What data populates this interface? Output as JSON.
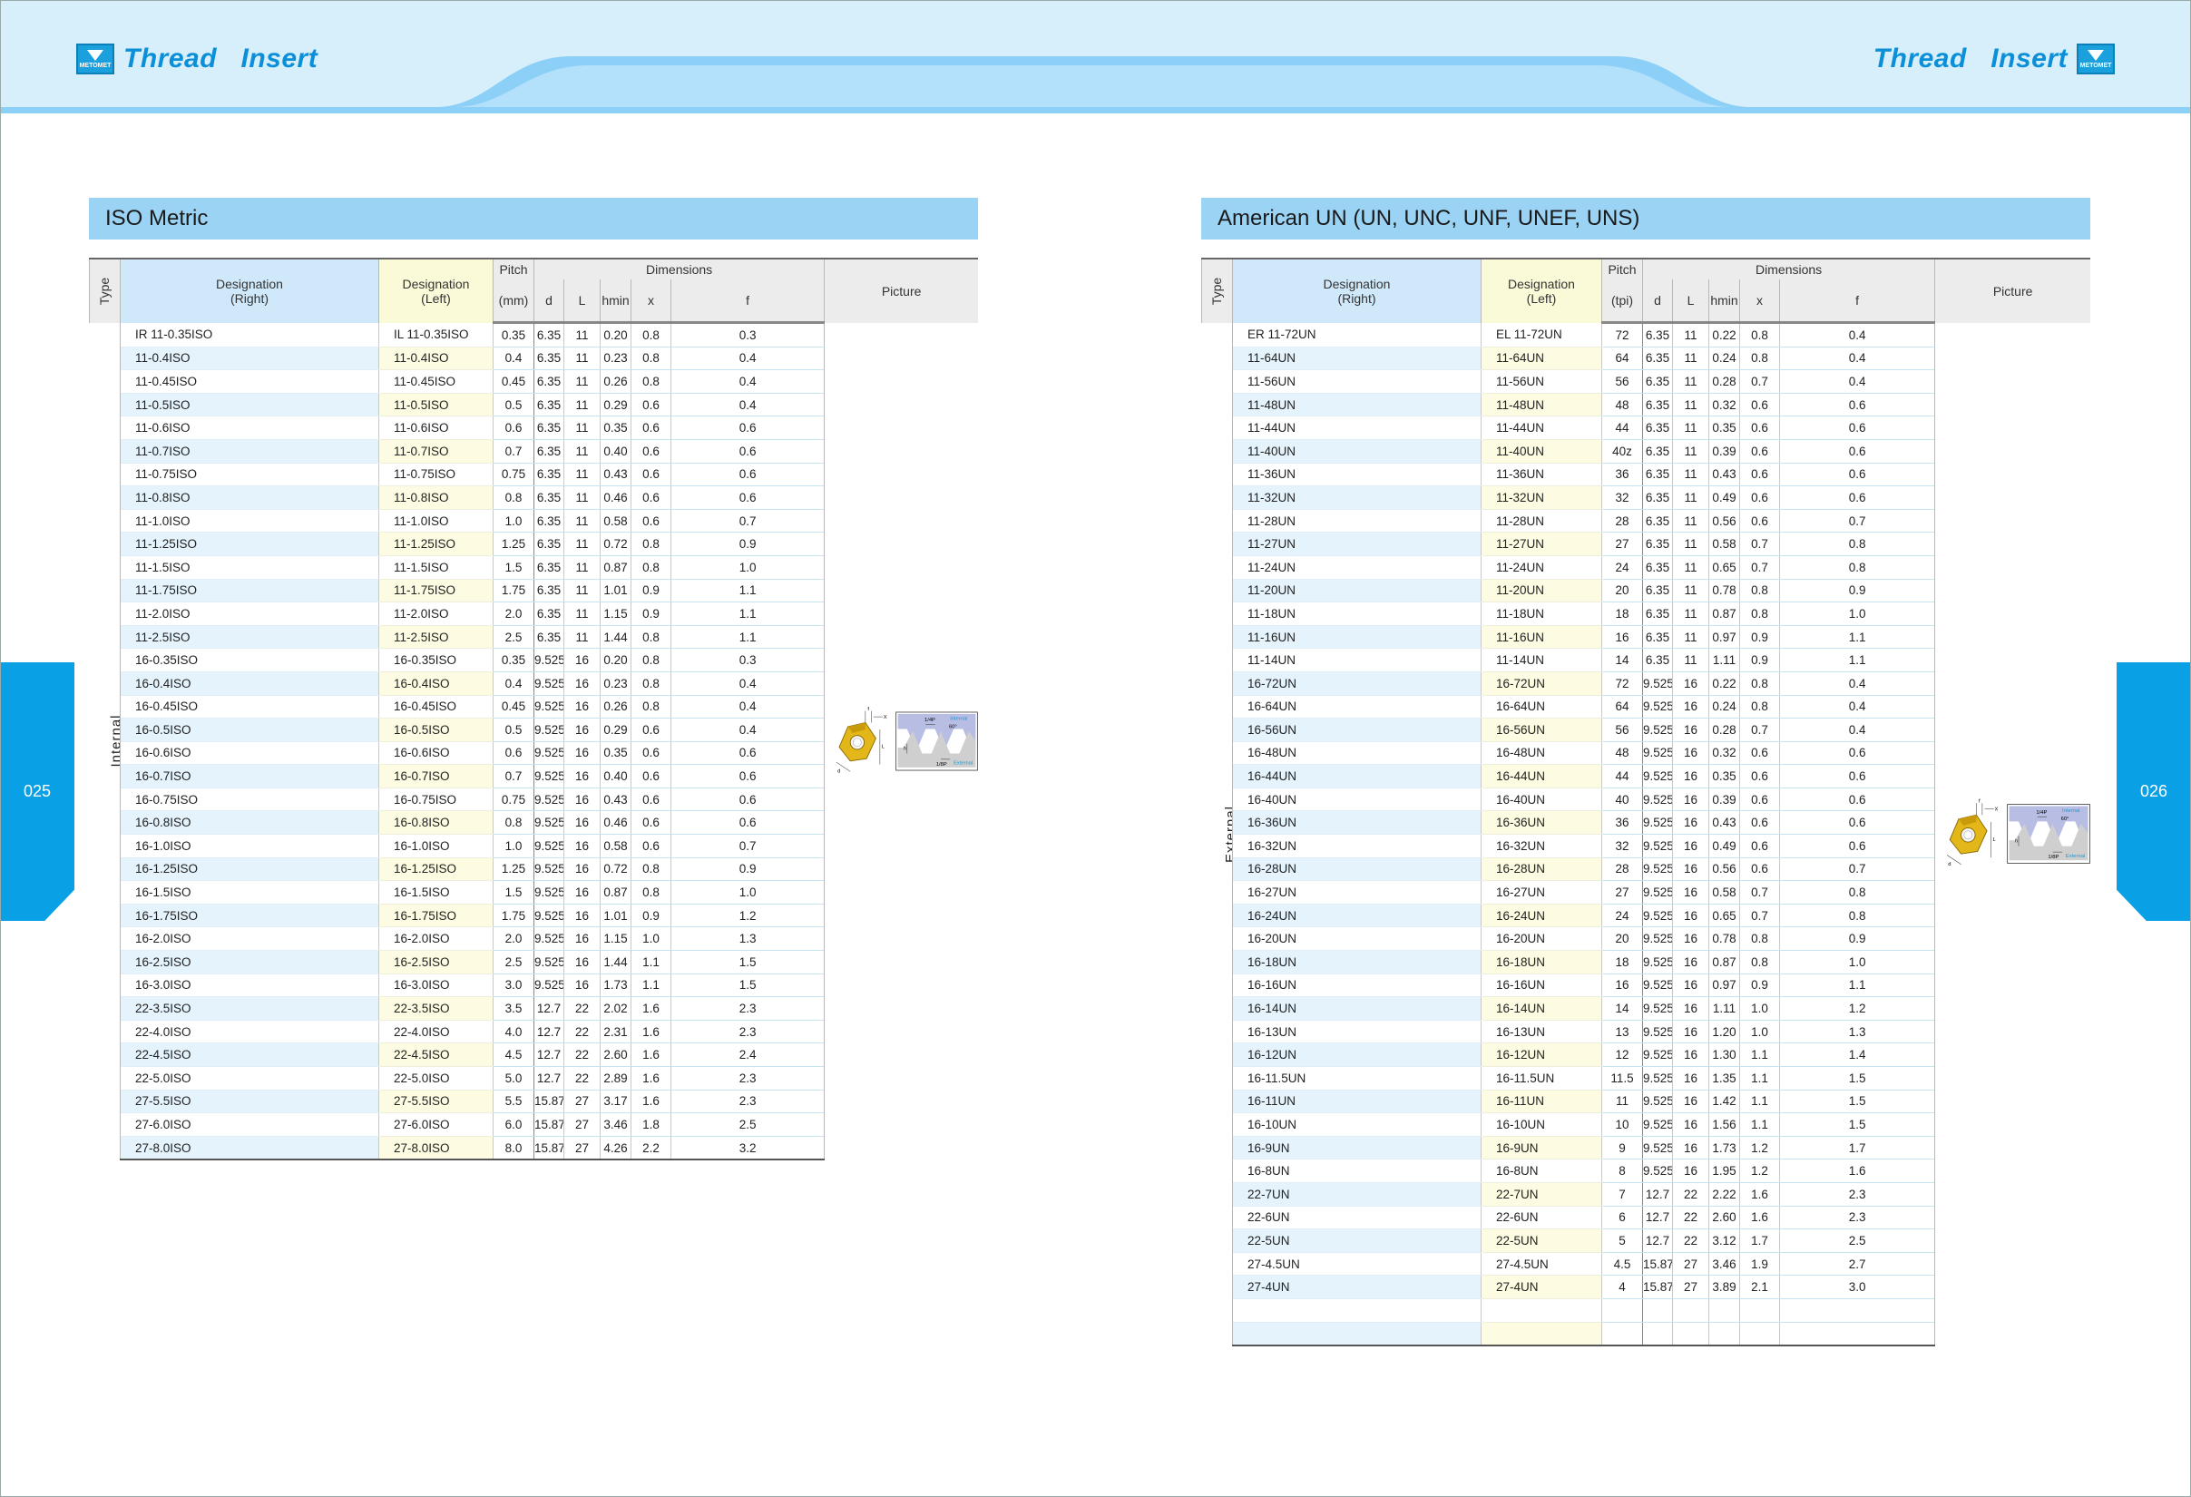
{
  "colors": {
    "accent": "#0a8fd8",
    "header_band": "#d7eefb",
    "wave": "#8cd0f7",
    "tab": "#0aa0e6",
    "section_title_bg": "#9bd3f5",
    "right_col_bg": "#cfe9fa",
    "left_col_bg": "#fbfad8"
  },
  "brand": {
    "logo_text": "METOMET",
    "title_left": "Thread   Insert",
    "title_right": "Thread   Insert"
  },
  "page_numbers": {
    "left": "025",
    "right": "026"
  },
  "headers": {
    "type": "Type",
    "designation_right": "Designation\n(Right)",
    "designation_left": "Designation\n(Left)",
    "dimensions": "Dimensions",
    "picture": "Picture",
    "d": "d",
    "L": "L",
    "hmin": "hmin",
    "x": "x",
    "f": "f",
    "pitch": "Pitch",
    "unit_mm": "(mm)",
    "unit_tpi": "(tpi)"
  },
  "diagram_labels": {
    "quarter_p": "1/4P",
    "eighth_p": "1/8P",
    "angle": "60°",
    "internal": "Internal",
    "external": "External",
    "f": "f",
    "x": "X",
    "L": "L",
    "d": "d",
    "h": "h"
  },
  "iso_metric": {
    "title": "ISO Metric",
    "type_label": "Internal",
    "rows": [
      [
        "IR  11-0.35ISO",
        "IL  11-0.35ISO",
        "0.35",
        "6.35",
        "11",
        "0.20",
        "0.8",
        "0.3"
      ],
      [
        "11-0.4ISO",
        "11-0.4ISO",
        "0.4",
        "6.35",
        "11",
        "0.23",
        "0.8",
        "0.4"
      ],
      [
        "11-0.45ISO",
        "11-0.45ISO",
        "0.45",
        "6.35",
        "11",
        "0.26",
        "0.8",
        "0.4"
      ],
      [
        "11-0.5ISO",
        "11-0.5ISO",
        "0.5",
        "6.35",
        "11",
        "0.29",
        "0.6",
        "0.4"
      ],
      [
        "11-0.6ISO",
        "11-0.6ISO",
        "0.6",
        "6.35",
        "11",
        "0.35",
        "0.6",
        "0.6"
      ],
      [
        "11-0.7ISO",
        "11-0.7ISO",
        "0.7",
        "6.35",
        "11",
        "0.40",
        "0.6",
        "0.6"
      ],
      [
        "11-0.75ISO",
        "11-0.75ISO",
        "0.75",
        "6.35",
        "11",
        "0.43",
        "0.6",
        "0.6"
      ],
      [
        "11-0.8ISO",
        "11-0.8ISO",
        "0.8",
        "6.35",
        "11",
        "0.46",
        "0.6",
        "0.6"
      ],
      [
        "11-1.0ISO",
        "11-1.0ISO",
        "1.0",
        "6.35",
        "11",
        "0.58",
        "0.6",
        "0.7"
      ],
      [
        "11-1.25ISO",
        "11-1.25ISO",
        "1.25",
        "6.35",
        "11",
        "0.72",
        "0.8",
        "0.9"
      ],
      [
        "11-1.5ISO",
        "11-1.5ISO",
        "1.5",
        "6.35",
        "11",
        "0.87",
        "0.8",
        "1.0"
      ],
      [
        "11-1.75ISO",
        "11-1.75ISO",
        "1.75",
        "6.35",
        "11",
        "1.01",
        "0.9",
        "1.1"
      ],
      [
        "11-2.0ISO",
        "11-2.0ISO",
        "2.0",
        "6.35",
        "11",
        "1.15",
        "0.9",
        "1.1"
      ],
      [
        "11-2.5ISO",
        "11-2.5ISO",
        "2.5",
        "6.35",
        "11",
        "1.44",
        "0.8",
        "1.1"
      ],
      [
        "16-0.35ISO",
        "16-0.35ISO",
        "0.35",
        "9.525",
        "16",
        "0.20",
        "0.8",
        "0.3"
      ],
      [
        "16-0.4ISO",
        "16-0.4ISO",
        "0.4",
        "9.525",
        "16",
        "0.23",
        "0.8",
        "0.4"
      ],
      [
        "16-0.45ISO",
        "16-0.45ISO",
        "0.45",
        "9.525",
        "16",
        "0.26",
        "0.8",
        "0.4"
      ],
      [
        "16-0.5ISO",
        "16-0.5ISO",
        "0.5",
        "9.525",
        "16",
        "0.29",
        "0.6",
        "0.4"
      ],
      [
        "16-0.6ISO",
        "16-0.6ISO",
        "0.6",
        "9.525",
        "16",
        "0.35",
        "0.6",
        "0.6"
      ],
      [
        "16-0.7ISO",
        "16-0.7ISO",
        "0.7",
        "9.525",
        "16",
        "0.40",
        "0.6",
        "0.6"
      ],
      [
        "16-0.75ISO",
        "16-0.75ISO",
        "0.75",
        "9.525",
        "16",
        "0.43",
        "0.6",
        "0.6"
      ],
      [
        "16-0.8ISO",
        "16-0.8ISO",
        "0.8",
        "9.525",
        "16",
        "0.46",
        "0.6",
        "0.6"
      ],
      [
        "16-1.0ISO",
        "16-1.0ISO",
        "1.0",
        "9.525",
        "16",
        "0.58",
        "0.6",
        "0.7"
      ],
      [
        "16-1.25ISO",
        "16-1.25ISO",
        "1.25",
        "9.525",
        "16",
        "0.72",
        "0.8",
        "0.9"
      ],
      [
        "16-1.5ISO",
        "16-1.5ISO",
        "1.5",
        "9.525",
        "16",
        "0.87",
        "0.8",
        "1.0"
      ],
      [
        "16-1.75ISO",
        "16-1.75ISO",
        "1.75",
        "9.525",
        "16",
        "1.01",
        "0.9",
        "1.2"
      ],
      [
        "16-2.0ISO",
        "16-2.0ISO",
        "2.0",
        "9.525",
        "16",
        "1.15",
        "1.0",
        "1.3"
      ],
      [
        "16-2.5ISO",
        "16-2.5ISO",
        "2.5",
        "9.525",
        "16",
        "1.44",
        "1.1",
        "1.5"
      ],
      [
        "16-3.0ISO",
        "16-3.0ISO",
        "3.0",
        "9.525",
        "16",
        "1.73",
        "1.1",
        "1.5"
      ],
      [
        "22-3.5ISO",
        "22-3.5ISO",
        "3.5",
        "12.7",
        "22",
        "2.02",
        "1.6",
        "2.3"
      ],
      [
        "22-4.0ISO",
        "22-4.0ISO",
        "4.0",
        "12.7",
        "22",
        "2.31",
        "1.6",
        "2.3"
      ],
      [
        "22-4.5ISO",
        "22-4.5ISO",
        "4.5",
        "12.7",
        "22",
        "2.60",
        "1.6",
        "2.4"
      ],
      [
        "22-5.0ISO",
        "22-5.0ISO",
        "5.0",
        "12.7",
        "22",
        "2.89",
        "1.6",
        "2.3"
      ],
      [
        "27-5.5ISO",
        "27-5.5ISO",
        "5.5",
        "15.875",
        "27",
        "3.17",
        "1.6",
        "2.3"
      ],
      [
        "27-6.0ISO",
        "27-6.0ISO",
        "6.0",
        "15.875",
        "27",
        "3.46",
        "1.8",
        "2.5"
      ],
      [
        "27-8.0ISO",
        "27-8.0ISO",
        "8.0",
        "15.875",
        "27",
        "4.26",
        "2.2",
        "3.2"
      ]
    ]
  },
  "american_un": {
    "title": "American UN (UN, UNC, UNF, UNEF, UNS)",
    "type_label": "External",
    "rows": [
      [
        "ER  11-72UN",
        "EL  11-72UN",
        "72",
        "6.35",
        "11",
        "0.22",
        "0.8",
        "0.4"
      ],
      [
        "11-64UN",
        "11-64UN",
        "64",
        "6.35",
        "11",
        "0.24",
        "0.8",
        "0.4"
      ],
      [
        "11-56UN",
        "11-56UN",
        "56",
        "6.35",
        "11",
        "0.28",
        "0.7",
        "0.4"
      ],
      [
        "11-48UN",
        "11-48UN",
        "48",
        "6.35",
        "11",
        "0.32",
        "0.6",
        "0.6"
      ],
      [
        "11-44UN",
        "11-44UN",
        "44",
        "6.35",
        "11",
        "0.35",
        "0.6",
        "0.6"
      ],
      [
        "11-40UN",
        "11-40UN",
        "40z",
        "6.35",
        "11",
        "0.39",
        "0.6",
        "0.6"
      ],
      [
        "11-36UN",
        "11-36UN",
        "36",
        "6.35",
        "11",
        "0.43",
        "0.6",
        "0.6"
      ],
      [
        "11-32UN",
        "11-32UN",
        "32",
        "6.35",
        "11",
        "0.49",
        "0.6",
        "0.6"
      ],
      [
        "11-28UN",
        "11-28UN",
        "28",
        "6.35",
        "11",
        "0.56",
        "0.6",
        "0.7"
      ],
      [
        "11-27UN",
        "11-27UN",
        "27",
        "6.35",
        "11",
        "0.58",
        "0.7",
        "0.8"
      ],
      [
        "11-24UN",
        "11-24UN",
        "24",
        "6.35",
        "11",
        "0.65",
        "0.7",
        "0.8"
      ],
      [
        "11-20UN",
        "11-20UN",
        "20",
        "6.35",
        "11",
        "0.78",
        "0.8",
        "0.9"
      ],
      [
        "11-18UN",
        "11-18UN",
        "18",
        "6.35",
        "11",
        "0.87",
        "0.8",
        "1.0"
      ],
      [
        "11-16UN",
        "11-16UN",
        "16",
        "6.35",
        "11",
        "0.97",
        "0.9",
        "1.1"
      ],
      [
        "11-14UN",
        "11-14UN",
        "14",
        "6.35",
        "11",
        "1.11",
        "0.9",
        "1.1"
      ],
      [
        "16-72UN",
        "16-72UN",
        "72",
        "9.525",
        "16",
        "0.22",
        "0.8",
        "0.4"
      ],
      [
        "16-64UN",
        "16-64UN",
        "64",
        "9.525",
        "16",
        "0.24",
        "0.8",
        "0.4"
      ],
      [
        "16-56UN",
        "16-56UN",
        "56",
        "9.525",
        "16",
        "0.28",
        "0.7",
        "0.4"
      ],
      [
        "16-48UN",
        "16-48UN",
        "48",
        "9.525",
        "16",
        "0.32",
        "0.6",
        "0.6"
      ],
      [
        "16-44UN",
        "16-44UN",
        "44",
        "9.525",
        "16",
        "0.35",
        "0.6",
        "0.6"
      ],
      [
        "16-40UN",
        "16-40UN",
        "40",
        "9.525",
        "16",
        "0.39",
        "0.6",
        "0.6"
      ],
      [
        "16-36UN",
        "16-36UN",
        "36",
        "9.525",
        "16",
        "0.43",
        "0.6",
        "0.6"
      ],
      [
        "16-32UN",
        "16-32UN",
        "32",
        "9.525",
        "16",
        "0.49",
        "0.6",
        "0.6"
      ],
      [
        "16-28UN",
        "16-28UN",
        "28",
        "9.525",
        "16",
        "0.56",
        "0.6",
        "0.7"
      ],
      [
        "16-27UN",
        "16-27UN",
        "27",
        "9.525",
        "16",
        "0.58",
        "0.7",
        "0.8"
      ],
      [
        "16-24UN",
        "16-24UN",
        "24",
        "9.525",
        "16",
        "0.65",
        "0.7",
        "0.8"
      ],
      [
        "16-20UN",
        "16-20UN",
        "20",
        "9.525",
        "16",
        "0.78",
        "0.8",
        "0.9"
      ],
      [
        "16-18UN",
        "16-18UN",
        "18",
        "9.525",
        "16",
        "0.87",
        "0.8",
        "1.0"
      ],
      [
        "16-16UN",
        "16-16UN",
        "16",
        "9.525",
        "16",
        "0.97",
        "0.9",
        "1.1"
      ],
      [
        "16-14UN",
        "16-14UN",
        "14",
        "9.525",
        "16",
        "1.11",
        "1.0",
        "1.2"
      ],
      [
        "16-13UN",
        "16-13UN",
        "13",
        "9.525",
        "16",
        "1.20",
        "1.0",
        "1.3"
      ],
      [
        "16-12UN",
        "16-12UN",
        "12",
        "9.525",
        "16",
        "1.30",
        "1.1",
        "1.4"
      ],
      [
        "16-11.5UN",
        "16-11.5UN",
        "11.5",
        "9.525",
        "16",
        "1.35",
        "1.1",
        "1.5"
      ],
      [
        "16-11UN",
        "16-11UN",
        "11",
        "9.525",
        "16",
        "1.42",
        "1.1",
        "1.5"
      ],
      [
        "16-10UN",
        "16-10UN",
        "10",
        "9.525",
        "16",
        "1.56",
        "1.1",
        "1.5"
      ],
      [
        "16-9UN",
        "16-9UN",
        "9",
        "9.525",
        "16",
        "1.73",
        "1.2",
        "1.7"
      ],
      [
        "16-8UN",
        "16-8UN",
        "8",
        "9.525",
        "16",
        "1.95",
        "1.2",
        "1.6"
      ],
      [
        "22-7UN",
        "22-7UN",
        "7",
        "12.7",
        "22",
        "2.22",
        "1.6",
        "2.3"
      ],
      [
        "22-6UN",
        "22-6UN",
        "6",
        "12.7",
        "22",
        "2.60",
        "1.6",
        "2.3"
      ],
      [
        "22-5UN",
        "22-5UN",
        "5",
        "12.7",
        "22",
        "3.12",
        "1.7",
        "2.5"
      ],
      [
        "27-4.5UN",
        "27-4.5UN",
        "4.5",
        "15.875",
        "27",
        "3.46",
        "1.9",
        "2.7"
      ],
      [
        "27-4UN",
        "27-4UN",
        "4",
        "15.875",
        "27",
        "3.89",
        "2.1",
        "3.0"
      ],
      [
        "",
        "",
        "",
        "",
        "",
        "",
        "",
        ""
      ],
      [
        "",
        "",
        "",
        "",
        "",
        "",
        "",
        ""
      ]
    ]
  }
}
